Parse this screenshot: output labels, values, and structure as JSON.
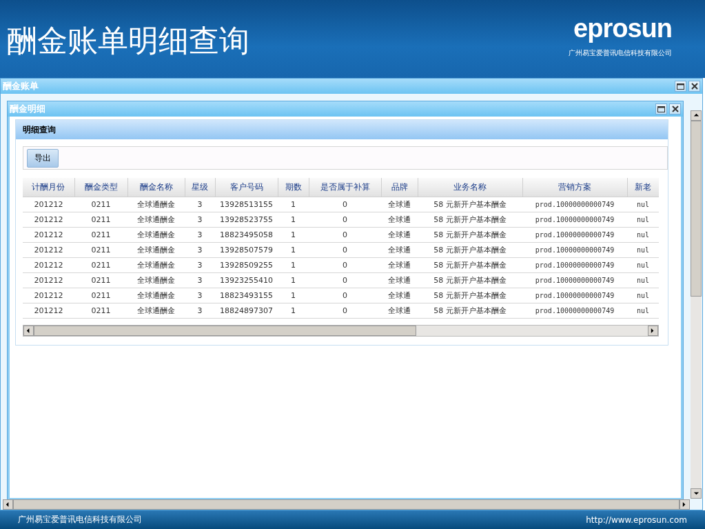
{
  "header": {
    "title": "酬金账单明细查询",
    "logo": "eprosun",
    "company": "广州易宝爱普讯电信科技有限公司"
  },
  "outer_window": {
    "title": "酬金账单"
  },
  "inner_window": {
    "title": "酬金明细"
  },
  "panel": {
    "title": "明细查询"
  },
  "toolbar": {
    "buttons": [
      "导出"
    ]
  },
  "table": {
    "columns": [
      "计酬月份",
      "酬金类型",
      "酬金名称",
      "星级",
      "客户号码",
      "期数",
      "是否属于补算",
      "品牌",
      "业务名称",
      "营销方案",
      "新老"
    ],
    "rows": [
      [
        "201212",
        "0211",
        "全球通酬金",
        "3",
        "13928513155",
        "1",
        "0",
        "全球通",
        "58 元新开户基本酬金",
        "prod.10000000000749",
        "nul"
      ],
      [
        "201212",
        "0211",
        "全球通酬金",
        "3",
        "13928523755",
        "1",
        "0",
        "全球通",
        "58 元新开户基本酬金",
        "prod.10000000000749",
        "nul"
      ],
      [
        "201212",
        "0211",
        "全球通酬金",
        "3",
        "18823495058",
        "1",
        "0",
        "全球通",
        "58 元新开户基本酬金",
        "prod.10000000000749",
        "nul"
      ],
      [
        "201212",
        "0211",
        "全球通酬金",
        "3",
        "13928507579",
        "1",
        "0",
        "全球通",
        "58 元新开户基本酬金",
        "prod.10000000000749",
        "nul"
      ],
      [
        "201212",
        "0211",
        "全球通酬金",
        "3",
        "13928509255",
        "1",
        "0",
        "全球通",
        "58 元新开户基本酬金",
        "prod.10000000000749",
        "nul"
      ],
      [
        "201212",
        "0211",
        "全球通酬金",
        "3",
        "13923255410",
        "1",
        "0",
        "全球通",
        "58 元新开户基本酬金",
        "prod.10000000000749",
        "nul"
      ],
      [
        "201212",
        "0211",
        "全球通酬金",
        "3",
        "18823493155",
        "1",
        "0",
        "全球通",
        "58 元新开户基本酬金",
        "prod.10000000000749",
        "nul"
      ],
      [
        "201212",
        "0211",
        "全球通酬金",
        "3",
        "18824897307",
        "1",
        "0",
        "全球通",
        "58 元新开户基本酬金",
        "prod.10000000000749",
        "nul"
      ]
    ]
  },
  "footer": {
    "company": "广州易宝爱普讯电信科技有限公司",
    "url": "http://www.eprosun.com"
  }
}
